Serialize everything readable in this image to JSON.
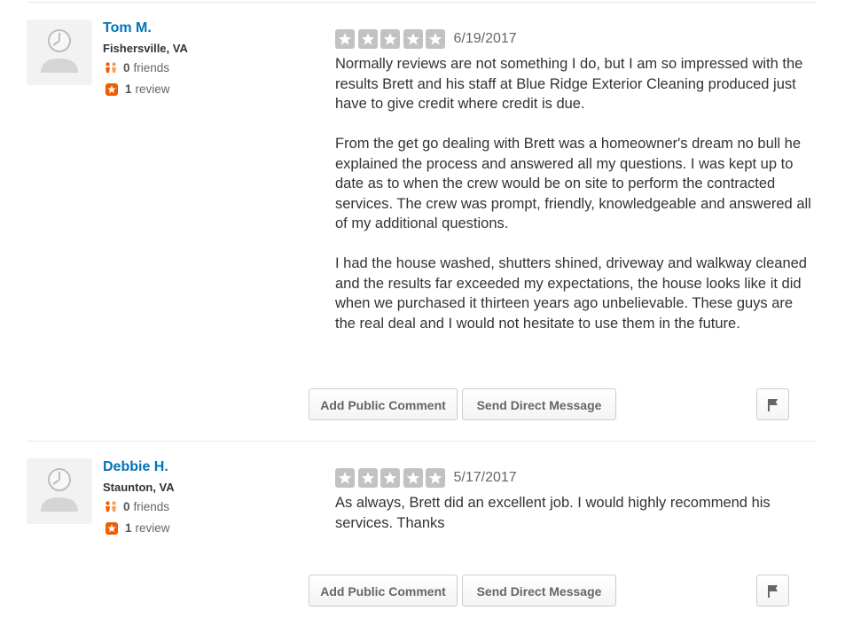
{
  "reviews": [
    {
      "user": {
        "name": "Tom M.",
        "location": "Fishersville, VA",
        "friends_count": "0",
        "friends_label": "friends",
        "review_count": "1",
        "review_label": "review"
      },
      "rating": 5,
      "date": "6/19/2017",
      "paragraphs": [
        "Normally reviews are not something I do, but I am so impressed with the results Brett and his staff at Blue Ridge Exterior Cleaning produced just have to give credit where credit is due.",
        "From the get go dealing with Brett was a homeowner's dream no bull he explained the process and answered all my questions.  I was kept up to date as to when the crew would be on site to perform the contracted services.  The crew was prompt, friendly, knowledgeable and answered all of my additional questions.",
        "I had the house washed, shutters shined, driveway and walkway cleaned and the results far exceeded my expectations, the house looks like it did when we purchased it thirteen years ago unbelievable.   These guys are the real deal and I would not hesitate to use them in the future."
      ],
      "buttons": {
        "comment": "Add Public Comment",
        "message": "Send Direct Message"
      }
    },
    {
      "user": {
        "name": "Debbie H.",
        "location": "Staunton, VA",
        "friends_count": "0",
        "friends_label": "friends",
        "review_count": "1",
        "review_label": "review"
      },
      "rating": 5,
      "date": "5/17/2017",
      "paragraphs": [
        "As always, Brett did an excellent job.  I would highly recommend his services.    Thanks"
      ],
      "buttons": {
        "comment": "Add Public Comment",
        "message": "Send Direct Message"
      }
    }
  ],
  "icons": {
    "avatar": "default-user-avatar-icon",
    "friends": "friends-icon",
    "review": "review-star-icon",
    "star": "rating-star-icon",
    "flag": "flag-icon"
  },
  "colors": {
    "user_name": "#0073bb",
    "review_badge": "#f15c00",
    "star_background": "#c2c2c2"
  }
}
